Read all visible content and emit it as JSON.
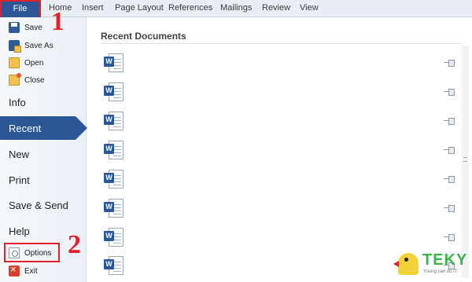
{
  "ribbon": {
    "file_tab": "File",
    "tabs": [
      "Home",
      "Insert",
      "Page Layout",
      "References",
      "Mailings",
      "Review",
      "View"
    ]
  },
  "backstage": {
    "commands": {
      "save": "Save",
      "save_as": "Save As",
      "open": "Open",
      "close": "Close",
      "options": "Options",
      "exit": "Exit"
    },
    "sections": {
      "info": "Info",
      "recent": "Recent",
      "new": "New",
      "print": "Print",
      "save_send": "Save & Send",
      "help": "Help"
    },
    "selected": "Recent"
  },
  "annotations": {
    "step1": "1",
    "step2": "2",
    "highlight_color": "#e0202b"
  },
  "main": {
    "title": "Recent Documents",
    "documents": [
      {
        "icon": "word-document-icon",
        "pinned": false
      },
      {
        "icon": "word-document-icon",
        "pinned": false
      },
      {
        "icon": "word-document-icon",
        "pinned": false
      },
      {
        "icon": "word-document-icon",
        "pinned": false
      },
      {
        "icon": "word-document-icon",
        "pinned": false
      },
      {
        "icon": "word-document-icon",
        "pinned": false
      },
      {
        "icon": "word-document-icon",
        "pinned": false
      },
      {
        "icon": "word-document-icon",
        "pinned": false
      }
    ],
    "word_badge": "W"
  },
  "watermark": {
    "brand": "TEKY",
    "tagline": "Young can do IT"
  },
  "colors": {
    "accent": "#2b5797",
    "logo_green": "#3bb54a"
  }
}
